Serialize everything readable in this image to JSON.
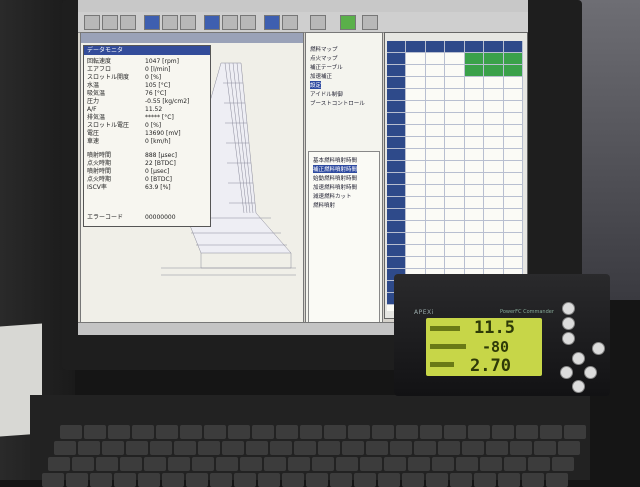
{
  "monitor": {
    "title": "データモニタ",
    "rows": [
      {
        "label": "回転速度",
        "value": "1047 [rpm]"
      },
      {
        "label": "エアフロ",
        "value": "0 [l/min]"
      },
      {
        "label": "スロットル開度",
        "value": "0 [%]"
      },
      {
        "label": "水温",
        "value": "105 [°C]"
      },
      {
        "label": "吸気温",
        "value": "76 [°C]"
      },
      {
        "label": "圧力",
        "value": "-0.55 [kg/cm2]"
      },
      {
        "label": "A/F",
        "value": "11.52"
      },
      {
        "label": "排気温",
        "value": "***** [°C]"
      },
      {
        "label": "スロットル電圧",
        "value": "0 [%]"
      },
      {
        "label": "電圧",
        "value": "13690 [mV]"
      },
      {
        "label": "車速",
        "value": "0 [km/h]"
      },
      {
        "label": "噴射時間",
        "value": "888 [μsec]"
      },
      {
        "label": "点火時期",
        "value": "22 [BTDC]"
      },
      {
        "label": "噴射時間",
        "value": "0 [μsec]"
      },
      {
        "label": "点火時期",
        "value": "0 [BTDC]"
      },
      {
        "label": "ISCV率",
        "value": "63.9 [%]"
      },
      {
        "label": "エラーコード",
        "value": "00000000"
      }
    ]
  },
  "tree": {
    "items": [
      "燃料マップ",
      "点火マップ",
      "補正テーブル",
      "加速補正",
      "設定",
      "アイドル制御",
      "ブーストコントロール"
    ],
    "selected_index": 4
  },
  "sub_list": {
    "items": [
      "基本燃料噴射時間",
      "補正燃料噴射時間",
      "始動燃料噴射時間",
      "加速燃料噴射時間",
      "減速燃料カット",
      "燃料噴射"
    ]
  },
  "device": {
    "brand": "APEXi",
    "model": "PowerFC Commander",
    "readouts": [
      "11.5",
      "-80",
      "2.70"
    ]
  },
  "colors": {
    "screen_bg": "#d6d3cc",
    "lcd_bg": "#c7d648",
    "title_blue": "#334c9a",
    "table_highlight": "#3aa14a"
  }
}
